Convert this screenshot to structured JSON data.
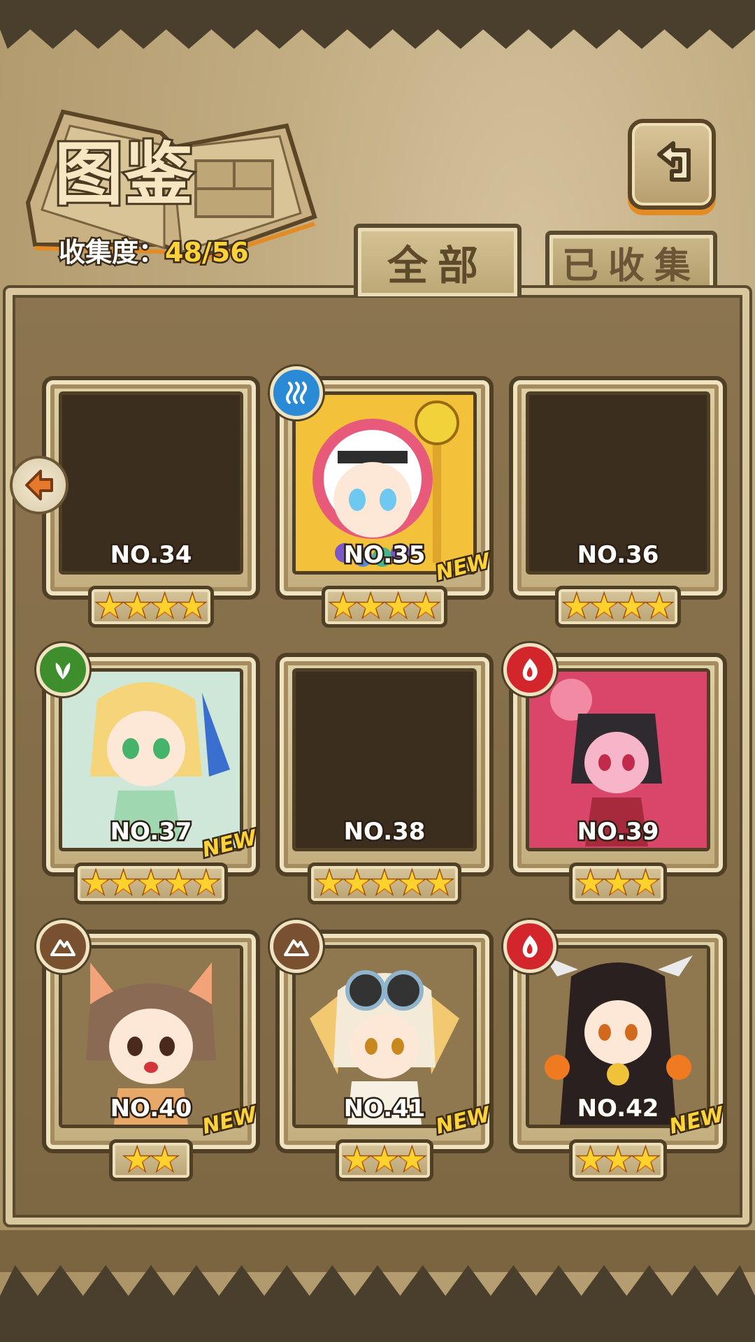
{
  "header": {
    "title": "图鉴",
    "collection_label": "收集度：",
    "collection_value": "48/56"
  },
  "tabs": [
    {
      "label": "全部",
      "active": true
    },
    {
      "label": "已收集",
      "active": false
    }
  ],
  "cards": [
    {
      "number": "NO.34",
      "stars": "★★★★",
      "unlocked": false,
      "is_new": false,
      "element": null
    },
    {
      "number": "NO.35",
      "stars": "★★★★",
      "unlocked": true,
      "is_new": true,
      "new_label": "NEW",
      "element": "water-icon"
    },
    {
      "number": "NO.36",
      "stars": "★★★★",
      "unlocked": false,
      "is_new": false,
      "element": null
    },
    {
      "number": "NO.37",
      "stars": "★★★★★",
      "unlocked": true,
      "is_new": true,
      "new_label": "NEW",
      "element": "leaf-icon"
    },
    {
      "number": "NO.38",
      "stars": "★★★★★",
      "unlocked": false,
      "is_new": false,
      "element": null
    },
    {
      "number": "NO.39",
      "stars": "★★★",
      "unlocked": true,
      "is_new": false,
      "element": "fire-icon"
    },
    {
      "number": "NO.40",
      "stars": "★★",
      "unlocked": true,
      "is_new": true,
      "new_label": "NEW",
      "element": "mountain-icon"
    },
    {
      "number": "NO.41",
      "stars": "★★★",
      "unlocked": true,
      "is_new": true,
      "new_label": "NEW",
      "element": "mountain-icon"
    },
    {
      "number": "NO.42",
      "stars": "★★★",
      "unlocked": true,
      "is_new": true,
      "new_label": "NEW",
      "element": "fire-icon"
    }
  ],
  "colors": {
    "accent_gold": "#ffd23a",
    "panel_brown": "#8b744e",
    "frame_light": "#dfd0a8",
    "water": "#2b8ad6",
    "leaf": "#3f8e2d",
    "fire": "#d2252c",
    "earth": "#7a5130"
  }
}
